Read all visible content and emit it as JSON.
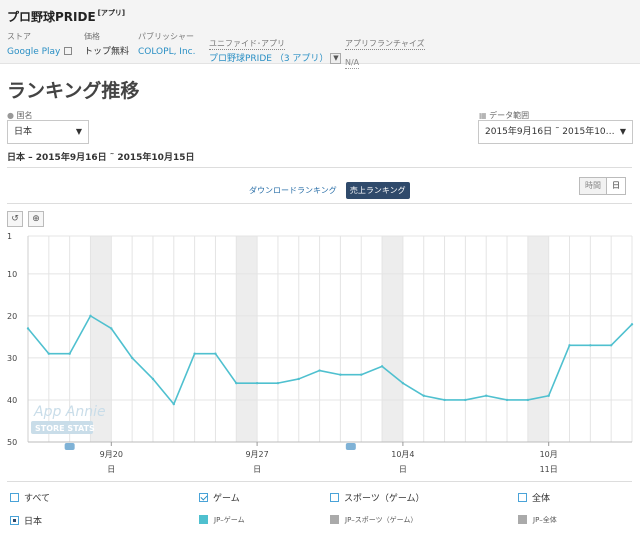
{
  "app": {
    "title": "プロ野球PRIDE",
    "title_tag": "[アプリ]",
    "store_label": "ストア",
    "store_value": "Google Play",
    "price_label": "価格",
    "price_value": "トップ無料",
    "publisher_label": "パブリッシャー",
    "publisher_value": "COLOPL, Inc.",
    "unified_label": "ユニファイド･アプリ",
    "unified_value": "プロ野球PRIDE （3 アプリ）",
    "franchise_label": "アプリフランチャイズ",
    "franchise_value": "N/A"
  },
  "page_title": "ランキング推移",
  "filters": {
    "country_label": "国名",
    "country_value": "日本",
    "date_label": "データ範囲",
    "date_value": "2015年9月16日 ˜ 2015年10…"
  },
  "range_text": "日本 – 2015年9月16日 ˜ 2015年10月15日",
  "tabs": {
    "download": "ダウンロードランキング",
    "revenue": "売上ランキング"
  },
  "granularity": {
    "hourly": "時間",
    "daily": "日"
  },
  "tools": {
    "reset": "↺",
    "zoom": "⊕"
  },
  "watermark": {
    "line1": "App Annie",
    "line2": "STORE STATS"
  },
  "chart_data": {
    "type": "line",
    "y_reversed": true,
    "ylim": [
      1,
      50
    ],
    "yticks": [
      1,
      10,
      20,
      30,
      40,
      50
    ],
    "x": [
      "2015-09-16",
      "2015-09-17",
      "2015-09-18",
      "2015-09-19",
      "2015-09-20",
      "2015-09-21",
      "2015-09-22",
      "2015-09-23",
      "2015-09-24",
      "2015-09-25",
      "2015-09-26",
      "2015-09-27",
      "2015-09-28",
      "2015-09-29",
      "2015-09-30",
      "2015-10-01",
      "2015-10-02",
      "2015-10-03",
      "2015-10-04",
      "2015-10-05",
      "2015-10-06",
      "2015-10-07",
      "2015-10-08",
      "2015-10-09",
      "2015-10-10",
      "2015-10-11",
      "2015-10-12",
      "2015-10-13",
      "2015-10-14",
      "2015-10-15"
    ],
    "series": [
      {
        "name": "JP–ゲーム",
        "color": "#4fc0cf",
        "values": [
          23,
          29,
          29,
          20,
          23,
          30,
          35,
          41,
          29,
          29,
          36,
          36,
          36,
          35,
          33,
          34,
          34,
          32,
          36,
          39,
          40,
          40,
          39,
          40,
          40,
          39,
          27,
          27,
          27,
          22
        ]
      }
    ],
    "xtick_labels": [
      {
        "date": "2015-09-20",
        "top": "9月20",
        "bottom": "日"
      },
      {
        "date": "2015-09-27",
        "top": "9月27",
        "bottom": "日"
      },
      {
        "date": "2015-10-04",
        "top": "10月4",
        "bottom": "日"
      },
      {
        "date": "2015-10-11",
        "top": "10月",
        "bottom": "11日"
      }
    ],
    "weekends": [
      [
        "2015-09-19",
        "2015-09-20"
      ],
      [
        "2015-09-26",
        "2015-09-27"
      ],
      [
        "2015-10-03",
        "2015-10-04"
      ],
      [
        "2015-10-10",
        "2015-10-11"
      ]
    ],
    "grid": true
  },
  "legend": {
    "all_label": "すべて",
    "game_label": "ゲーム",
    "sports_label": "スポーツ（ゲーム）",
    "overall_label": "全体",
    "country_label": "日本",
    "jp_game": "JP–ゲーム",
    "jp_sports": "JP–スポーツ（ゲーム）",
    "jp_overall": "JP–全体",
    "colors": {
      "game": "#4fc0cf",
      "sports": "#aaaaaa",
      "overall": "#aaaaaa"
    }
  }
}
